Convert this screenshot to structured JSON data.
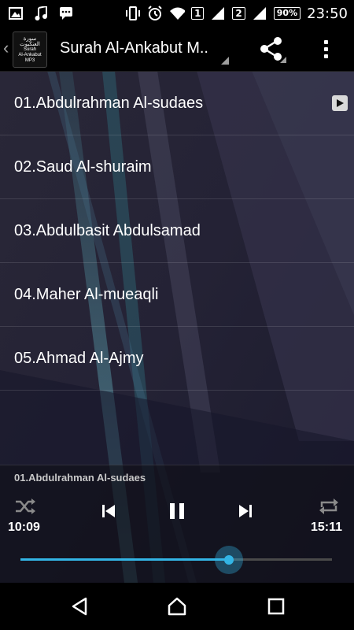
{
  "status_bar": {
    "sim1": "1",
    "sim2": "2",
    "battery": "90%",
    "time": "23:50"
  },
  "action_bar": {
    "app_icon": {
      "line1": "سورة العنكبوت",
      "line2": "Surah",
      "line3": "Al-Ankabut MP3"
    },
    "title": "Surah Al-Ankabut M.."
  },
  "list": {
    "items": [
      {
        "label": "01.Abdulrahman Al-sudaes",
        "playing": true
      },
      {
        "label": "02.Saud Al-shuraim"
      },
      {
        "label": "03.Abdulbasit Abdulsamad"
      },
      {
        "label": "04.Maher Al-mueaqli"
      },
      {
        "label": "05.Ahmad Al-Ajmy"
      }
    ]
  },
  "player": {
    "now_playing": "01.Abdulrahman Al-sudaes",
    "elapsed": "10:09",
    "duration": "15:11",
    "progress": 0.67
  },
  "colors": {
    "accent": "#33b5e5"
  }
}
